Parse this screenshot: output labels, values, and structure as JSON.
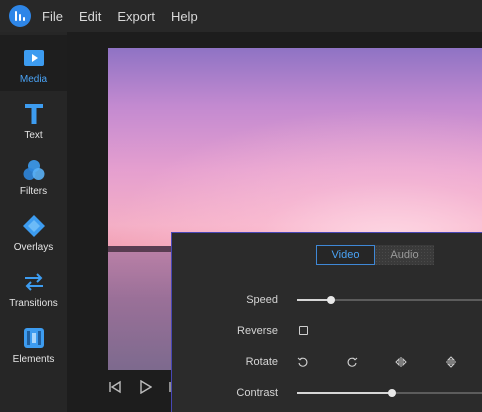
{
  "menubar": {
    "items": [
      "File",
      "Edit",
      "Export",
      "Help"
    ]
  },
  "sidebar": {
    "items": [
      {
        "label": "Media",
        "icon": "media-icon",
        "active": true
      },
      {
        "label": "Text",
        "icon": "text-icon",
        "active": false
      },
      {
        "label": "Filters",
        "icon": "filters-icon",
        "active": false
      },
      {
        "label": "Overlays",
        "icon": "overlays-icon",
        "active": false
      },
      {
        "label": "Transitions",
        "icon": "transitions-icon",
        "active": false
      },
      {
        "label": "Elements",
        "icon": "elements-icon",
        "active": false
      }
    ]
  },
  "panel": {
    "tabs": [
      {
        "label": "Video",
        "active": true
      },
      {
        "label": "Audio",
        "active": false
      }
    ],
    "speed_label": "Speed",
    "speed_value": 0.18,
    "reverse_label": "Reverse",
    "reverse_checked": false,
    "rotate_label": "Rotate",
    "rotate_icons": [
      "rotate-left-icon",
      "rotate-right-icon",
      "flip-horizontal-icon",
      "flip-vertical-icon"
    ],
    "contrast_label": "Contrast",
    "contrast_value": 0.5
  },
  "colors": {
    "accent": "#4aa3f5",
    "panel_border": "#4747b5"
  }
}
